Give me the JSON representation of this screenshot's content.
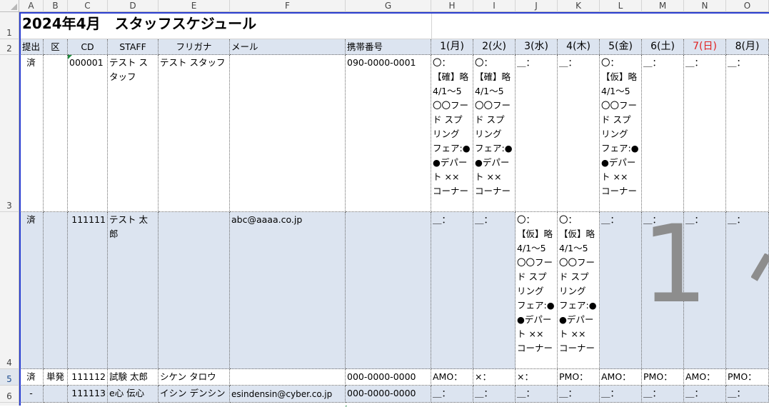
{
  "columns": [
    "A",
    "B",
    "C",
    "D",
    "E",
    "F",
    "G",
    "H",
    "I",
    "J",
    "K",
    "L",
    "M",
    "N",
    "O"
  ],
  "rows": [
    "1",
    "2",
    "3",
    "4",
    "5",
    "6"
  ],
  "title": "2024年4月　スタッフスケジュール",
  "headers": {
    "submitted": "提出",
    "category": "区",
    "cd": "CD",
    "staff": "STAFF",
    "furigana": "フリガナ",
    "email": "メール",
    "mobile": "携帯番号",
    "days": [
      "1(月)",
      "2(火)",
      "3(水)",
      "4(木)",
      "5(金)",
      "6(土)",
      "7(日)",
      "8(月)"
    ]
  },
  "records": [
    {
      "submitted": "済",
      "category": "",
      "cd": "000001",
      "staff": "テスト ス\nタッフ",
      "furigana": "テスト スタッフ",
      "email": "",
      "mobile": "090-0000-0001",
      "days": [
        "〇：\n【確】略\n4/1～5\n〇〇フー\nド スプ\nリング\nフェア:●\n●デパー\nト ××\nコーナー",
        "〇：\n【確】略\n4/1～5\n〇〇フー\nド スプ\nリング\nフェア:●\n●デパー\nト ××\nコーナー",
        "＿：",
        "＿：",
        "〇：\n【仮】略\n4/1～5\n〇〇フー\nド スプ\nリング\nフェア:●\n●デパー\nト ××\nコーナー",
        "＿：",
        "＿：",
        "＿："
      ]
    },
    {
      "submitted": "済",
      "category": "",
      "cd": "111111",
      "staff": "テスト 太郎",
      "furigana": "",
      "email": "abc@aaaa.co.jp",
      "mobile": "",
      "days": [
        "＿：",
        "＿：",
        "〇：\n【仮】略\n4/1～5\n〇〇フー\nド スプ\nリング\nフェア:●\n●デパー\nト ××\nコーナー",
        "〇：\n【仮】略\n4/1～5\n〇〇フー\nド スプ\nリング\nフェア:●\n●デパー\nト ××\nコーナー",
        "＿：",
        "＿：",
        "＿：",
        "＿："
      ]
    },
    {
      "submitted": "済",
      "category": "単発",
      "cd": "111112",
      "staff": "試験 太郎",
      "furigana": "シケン タロウ",
      "email": "",
      "mobile": "000-0000-0000",
      "days": [
        "AMO：",
        "×：",
        "×：",
        "PMO：",
        "AMO：",
        "PMO：",
        "AMO：",
        "PMO："
      ]
    },
    {
      "submitted": "-",
      "category": "",
      "cd": "111113",
      "staff": "e心 伝心",
      "furigana": "イシン デンシン",
      "email": "esindensin@cyber.co.jp",
      "mobile": "000-0000-0000",
      "days": [
        "＿：",
        "＿：",
        "＿：",
        "＿：",
        "＿：",
        "＿：",
        "＿：",
        "＿："
      ]
    }
  ],
  "watermark": "1",
  "colors": {
    "header_bg": "#dce4f0",
    "blue_row_bg": "#dce4f0",
    "sunday_text": "#e02020",
    "comment_marker": "#1d8a3e"
  }
}
